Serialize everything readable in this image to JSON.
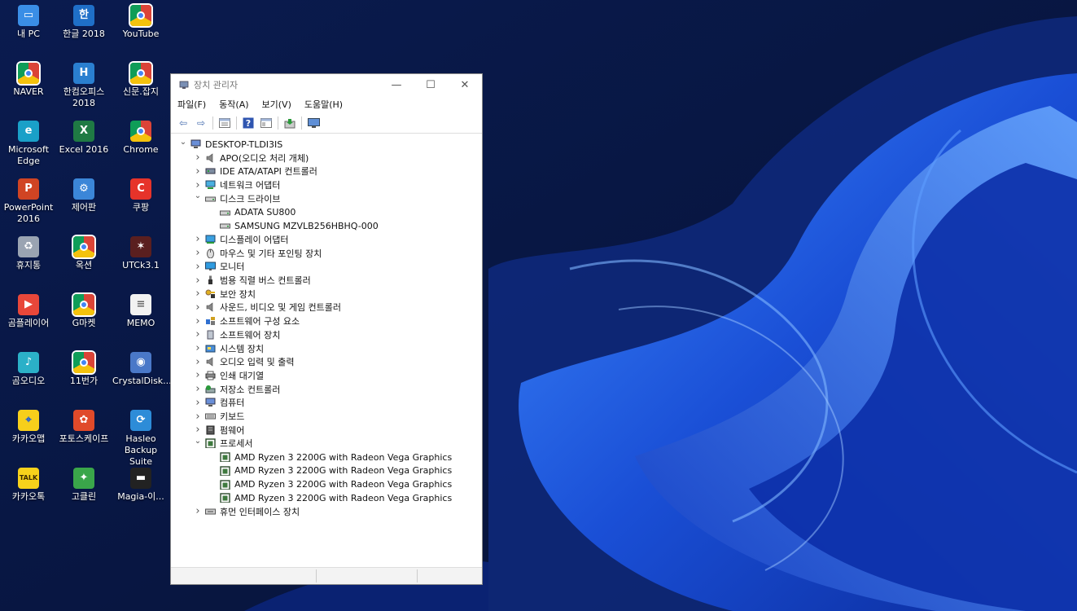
{
  "desktop": {
    "icons": [
      {
        "label": "내 PC",
        "icon": "pc-icon"
      },
      {
        "label": "한글 2018",
        "icon": "hangul-icon"
      },
      {
        "label": "YouTube",
        "icon": "chrome-shortcut-icon"
      },
      {
        "label": "NAVER",
        "icon": "chrome-shortcut-icon"
      },
      {
        "label": "한컴오피스 2018",
        "icon": "hancom-icon"
      },
      {
        "label": "신문.잡지",
        "icon": "chrome-shortcut-icon"
      },
      {
        "label": "Microsoft Edge",
        "icon": "edge-icon"
      },
      {
        "label": "Excel 2016",
        "icon": "excel-icon"
      },
      {
        "label": "Chrome",
        "icon": "chrome-icon"
      },
      {
        "label": "PowerPoint 2016",
        "icon": "powerpoint-icon"
      },
      {
        "label": "제어판",
        "icon": "control-panel-icon"
      },
      {
        "label": "쿠팡",
        "icon": "coupang-icon"
      },
      {
        "label": "휴지통",
        "icon": "recycle-bin-icon"
      },
      {
        "label": "옥션",
        "icon": "chrome-shortcut-icon"
      },
      {
        "label": "UTCk3.1",
        "icon": "utck-icon"
      },
      {
        "label": "곰플레이어",
        "icon": "gom-player-icon"
      },
      {
        "label": "G마켓",
        "icon": "chrome-shortcut-icon"
      },
      {
        "label": "MEMO",
        "icon": "memo-icon"
      },
      {
        "label": "곰오디오",
        "icon": "gom-audio-icon"
      },
      {
        "label": "11번가",
        "icon": "chrome-shortcut-icon"
      },
      {
        "label": "CrystalDisk...",
        "icon": "crystaldisk-icon"
      },
      {
        "label": "카카오맵",
        "icon": "kakao-map-icon"
      },
      {
        "label": "포토스케이프",
        "icon": "photoscape-icon"
      },
      {
        "label": "Hasleo Backup Suite",
        "icon": "hasleo-icon"
      },
      {
        "label": "카카오톡",
        "icon": "kakaotalk-icon"
      },
      {
        "label": "고클린",
        "icon": "goclean-icon"
      },
      {
        "label": "Magia-이...",
        "icon": "magia-icon"
      }
    ]
  },
  "window": {
    "title": "장치 관리자",
    "minimize": "—",
    "maximize": "☐",
    "close": "✕",
    "menu": [
      "파일(F)",
      "동작(A)",
      "보기(V)",
      "도움말(H)"
    ],
    "toolbar_icons": [
      "back-icon",
      "forward-icon",
      "properties-icon",
      "help-icon",
      "view-icon",
      "update-driver-icon",
      "monitor-icon"
    ],
    "tree": [
      {
        "label": "DESKTOP-TLDI3IS",
        "level": 0,
        "expand": "down",
        "icon": "computer-icon"
      },
      {
        "label": "APO(오디오 처리 개체)",
        "level": 1,
        "expand": "right",
        "icon": "speaker-icon"
      },
      {
        "label": "IDE ATA/ATAPI 컨트롤러",
        "level": 1,
        "expand": "right",
        "icon": "ide-icon"
      },
      {
        "label": "네트워크 어댑터",
        "level": 1,
        "expand": "right",
        "icon": "network-icon"
      },
      {
        "label": "디스크 드라이브",
        "level": 1,
        "expand": "down",
        "icon": "disk-icon"
      },
      {
        "label": "ADATA SU800",
        "level": 2,
        "expand": "",
        "icon": "disk-icon"
      },
      {
        "label": "SAMSUNG MZVLB256HBHQ-000",
        "level": 2,
        "expand": "",
        "icon": "disk-icon"
      },
      {
        "label": "디스플레이 어댑터",
        "level": 1,
        "expand": "right",
        "icon": "display-icon"
      },
      {
        "label": "마우스 및 기타 포인팅 장치",
        "level": 1,
        "expand": "right",
        "icon": "mouse-icon"
      },
      {
        "label": "모니터",
        "level": 1,
        "expand": "right",
        "icon": "monitor-icon"
      },
      {
        "label": "범용 직렬 버스 컨트롤러",
        "level": 1,
        "expand": "right",
        "icon": "usb-icon"
      },
      {
        "label": "보안 장치",
        "level": 1,
        "expand": "right",
        "icon": "security-icon"
      },
      {
        "label": "사운드, 비디오 및 게임 컨트롤러",
        "level": 1,
        "expand": "right",
        "icon": "speaker-icon"
      },
      {
        "label": "소프트웨어 구성 요소",
        "level": 1,
        "expand": "right",
        "icon": "software-component-icon"
      },
      {
        "label": "소프트웨어 장치",
        "level": 1,
        "expand": "right",
        "icon": "software-device-icon"
      },
      {
        "label": "시스템 장치",
        "level": 1,
        "expand": "right",
        "icon": "system-icon"
      },
      {
        "label": "오디오 입력 및 출력",
        "level": 1,
        "expand": "right",
        "icon": "speaker-icon"
      },
      {
        "label": "인쇄 대기열",
        "level": 1,
        "expand": "right",
        "icon": "printer-icon"
      },
      {
        "label": "저장소 컨트롤러",
        "level": 1,
        "expand": "right",
        "icon": "storage-icon"
      },
      {
        "label": "컴퓨터",
        "level": 1,
        "expand": "right",
        "icon": "computer-icon"
      },
      {
        "label": "키보드",
        "level": 1,
        "expand": "right",
        "icon": "keyboard-icon"
      },
      {
        "label": "펌웨어",
        "level": 1,
        "expand": "right",
        "icon": "firmware-icon"
      },
      {
        "label": "프로세서",
        "level": 1,
        "expand": "down",
        "icon": "processor-icon"
      },
      {
        "label": "AMD Ryzen 3 2200G with Radeon Vega Graphics",
        "level": 2,
        "expand": "",
        "icon": "processor-icon"
      },
      {
        "label": "AMD Ryzen 3 2200G with Radeon Vega Graphics",
        "level": 2,
        "expand": "",
        "icon": "processor-icon"
      },
      {
        "label": "AMD Ryzen 3 2200G with Radeon Vega Graphics",
        "level": 2,
        "expand": "",
        "icon": "processor-icon"
      },
      {
        "label": "AMD Ryzen 3 2200G with Radeon Vega Graphics",
        "level": 2,
        "expand": "",
        "icon": "processor-icon"
      },
      {
        "label": "휴먼 인터페이스 장치",
        "level": 1,
        "expand": "right",
        "icon": "hid-icon"
      }
    ]
  }
}
